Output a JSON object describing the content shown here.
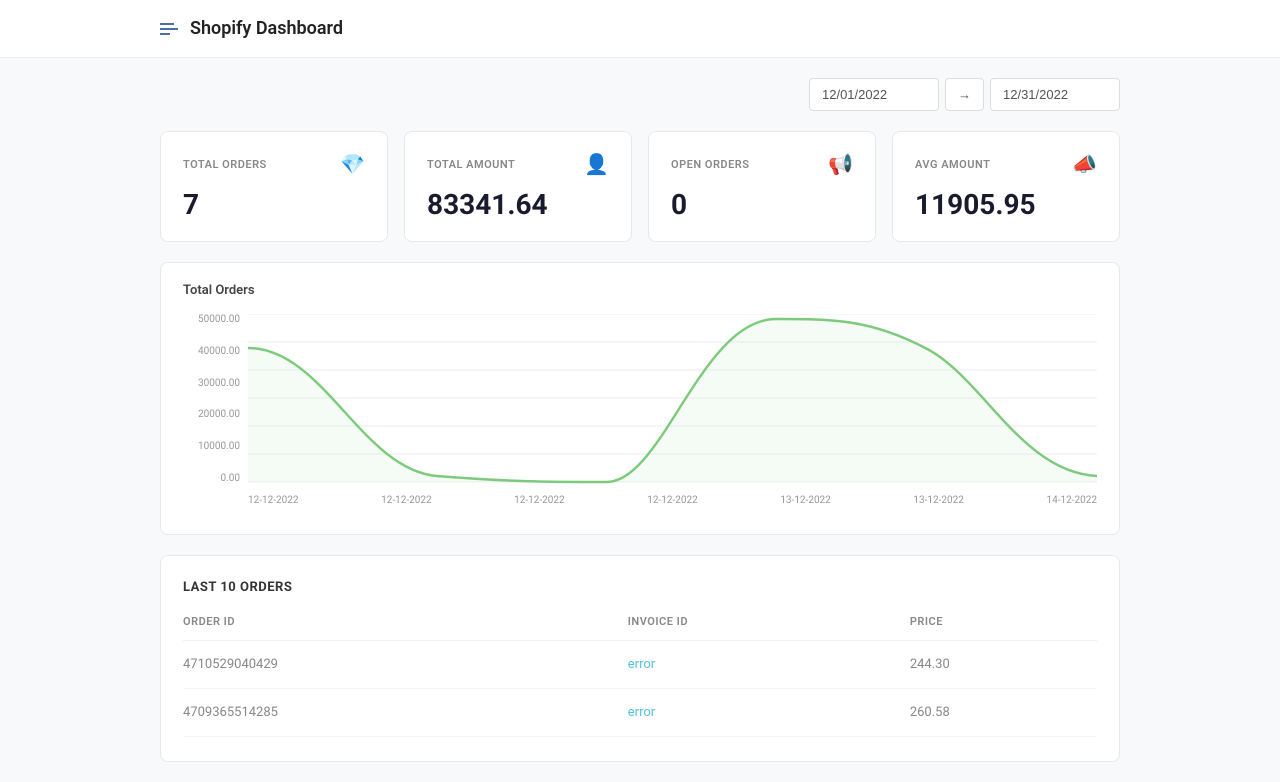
{
  "header": {
    "title": "Shopify Dashboard",
    "menu_icon": "menu-icon"
  },
  "date_range": {
    "start": "12/01/2022",
    "end": "12/31/2022",
    "arrow": "→"
  },
  "stats": [
    {
      "label": "TOTAL ORDERS",
      "value": "7",
      "icon": "💎",
      "icon_name": "diamond-icon",
      "icon_color": "#4a90d9"
    },
    {
      "label": "TOTAL AMOUNT",
      "value": "83341.64",
      "icon": "👤",
      "icon_name": "user-plus-icon",
      "icon_color": "#e67e5a"
    },
    {
      "label": "OPEN ORDERS",
      "value": "0",
      "icon": "📢",
      "icon_name": "megaphone-icon",
      "icon_color": "#5cb85c"
    },
    {
      "label": "AVG AMOUNT",
      "value": "11905.95",
      "icon": "📣",
      "icon_name": "loudspeaker-icon",
      "icon_color": "#5cb85c"
    }
  ],
  "chart": {
    "title": "Total Orders",
    "y_labels": [
      "50000.00",
      "40000.00",
      "30000.00",
      "20000.00",
      "10000.00",
      "0.00"
    ],
    "x_labels": [
      "12-12-2022",
      "12-12-2022",
      "12-12-2022",
      "12-12-2022",
      "13-12-2022",
      "13-12-2022",
      "14-12-2022"
    ]
  },
  "orders_table": {
    "title": "LAST 10 ORDERS",
    "columns": [
      "ORDER ID",
      "INVOICE ID",
      "PRICE"
    ],
    "rows": [
      {
        "order_id": "4710529040429",
        "invoice_id": "error",
        "price": "244.30"
      },
      {
        "order_id": "4709365514285",
        "invoice_id": "error",
        "price": "260.58"
      }
    ]
  }
}
